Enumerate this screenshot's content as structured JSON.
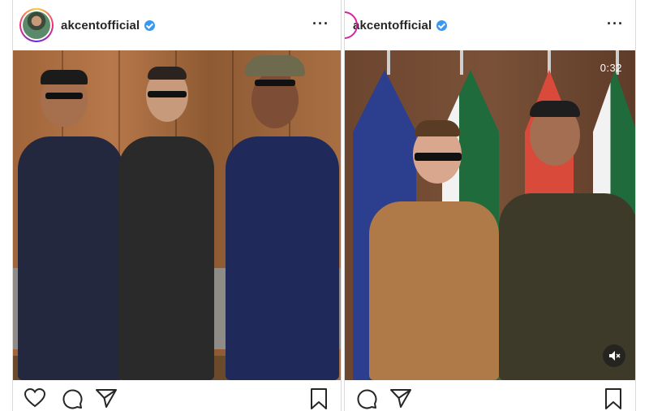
{
  "posts": [
    {
      "username": "akcentofficial",
      "verified": true,
      "more_icon": "more-horizontal-icon",
      "actions": [
        "heart-icon",
        "comment-icon",
        "share-icon",
        "bookmark-icon"
      ]
    },
    {
      "username": "akcentofficial",
      "verified": true,
      "video_time": "0:32",
      "more_icon": "more-horizontal-icon",
      "actions": [
        "comment-icon",
        "share-icon",
        "bookmark-icon"
      ],
      "mute_icon": "speaker-muted-icon"
    }
  ],
  "colors": {
    "verified_blue": "#3897f0",
    "story_ring": "#d6249f",
    "text": "#262626"
  }
}
